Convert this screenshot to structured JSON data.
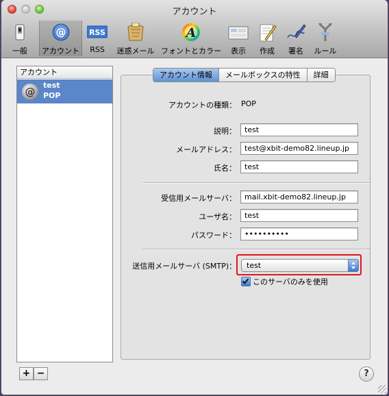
{
  "window": {
    "title": "アカウント"
  },
  "toolbar": {
    "items": [
      {
        "id": "general",
        "label": "一般",
        "icon": "switch-icon"
      },
      {
        "id": "accounts",
        "label": "アカウント",
        "icon": "at-sign-icon",
        "selected": true
      },
      {
        "id": "rss",
        "label": "RSS",
        "icon": "rss-icon",
        "icon_text": "RSS"
      },
      {
        "id": "junk",
        "label": "迷惑メール",
        "icon": "junk-mail-icon"
      },
      {
        "id": "fonts",
        "label": "フォントとカラー",
        "icon": "font-color-icon",
        "icon_text": "A"
      },
      {
        "id": "viewing",
        "label": "表示",
        "icon": "viewing-icon"
      },
      {
        "id": "composing",
        "label": "作成",
        "icon": "composing-icon"
      },
      {
        "id": "signatures",
        "label": "署名",
        "icon": "signature-icon"
      },
      {
        "id": "rules",
        "label": "ルール",
        "icon": "rules-icon"
      }
    ]
  },
  "accounts_list": {
    "header": "アカウント",
    "items": [
      {
        "name": "test",
        "type": "POP",
        "icon": "at-sign-icon",
        "icon_text": "@"
      }
    ]
  },
  "buttons": {
    "add": "+",
    "remove": "−",
    "help": "?"
  },
  "tabs": [
    {
      "label": "アカウント情報",
      "selected": true
    },
    {
      "label": "メールボックスの特性"
    },
    {
      "label": "詳細"
    }
  ],
  "form": {
    "account_type_label": "アカウントの種類：",
    "account_type_value": "POP",
    "description_label": "説明：",
    "description_value": "test",
    "email_label": "メールアドレス：",
    "email_value": "test@xbit-demo82.lineup.jp",
    "fullname_label": "氏名：",
    "fullname_value": "test",
    "incoming_label": "受信用メールサーバ：",
    "incoming_value": "mail.xbit-demo82.lineup.jp",
    "username_label": "ユーザ名：",
    "username_value": "test",
    "password_label": "パスワード：",
    "password_value": "••••••••••",
    "smtp_label": "送信用メールサーバ (SMTP)：",
    "smtp_value": "test",
    "only_this_server_label": "このサーバのみを使用",
    "only_this_server_checked": true
  },
  "colors": {
    "selection": "#5b86c8",
    "highlight_box": "#e1141b",
    "accent": "#3d78cf"
  }
}
